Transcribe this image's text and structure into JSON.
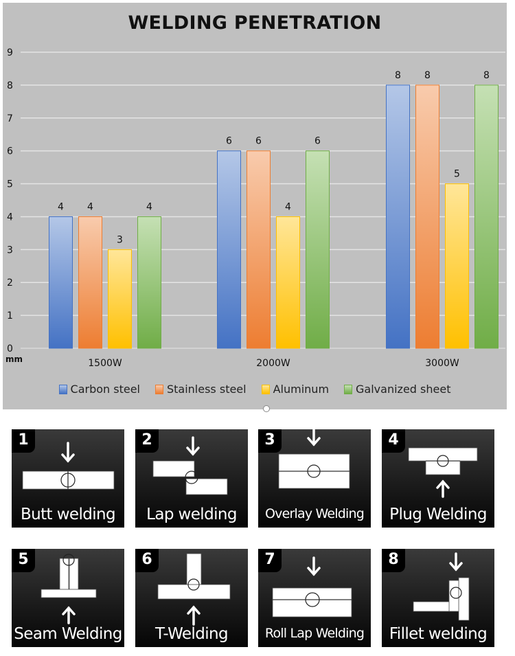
{
  "chart_data": {
    "type": "bar",
    "title": "WELDING PENETRATION",
    "xlabel": "",
    "ylabel": "mm",
    "ylim": [
      0,
      9
    ],
    "yticks": [
      "0",
      "1",
      "2",
      "3",
      "4",
      "5",
      "6",
      "7",
      "8",
      "9"
    ],
    "grid": true,
    "legend_position": "bottom",
    "categories": [
      "1500W",
      "2000W",
      "3000W"
    ],
    "series": [
      {
        "name": "Carbon steel",
        "color": "#4472C4",
        "light": "#B4C7E7",
        "values": [
          4,
          6,
          8
        ]
      },
      {
        "name": "Stainless steel",
        "color": "#ED7D31",
        "light": "#F8CBAD",
        "values": [
          4,
          6,
          8
        ]
      },
      {
        "name": "Aluminum",
        "color": "#FFC000",
        "light": "#FFE699",
        "values": [
          3,
          4,
          5
        ]
      },
      {
        "name": "Galvanized sheet",
        "color": "#70AD47",
        "light": "#C5E0B4",
        "values": [
          4,
          6,
          8
        ]
      }
    ]
  },
  "welding_types": [
    {
      "number": "1",
      "label": "Butt welding",
      "diagram": "butt"
    },
    {
      "number": "2",
      "label": "Lap welding",
      "diagram": "lap"
    },
    {
      "number": "3",
      "label": "Overlay Welding",
      "diagram": "overlay"
    },
    {
      "number": "4",
      "label": "Plug Welding",
      "diagram": "plug"
    },
    {
      "number": "5",
      "label": "Seam Welding",
      "diagram": "seam"
    },
    {
      "number": "6",
      "label": "T-Welding",
      "diagram": "t"
    },
    {
      "number": "7",
      "label": "Roll Lap Welding",
      "diagram": "rolllap"
    },
    {
      "number": "8",
      "label": "Fillet welding",
      "diagram": "fillet"
    }
  ]
}
